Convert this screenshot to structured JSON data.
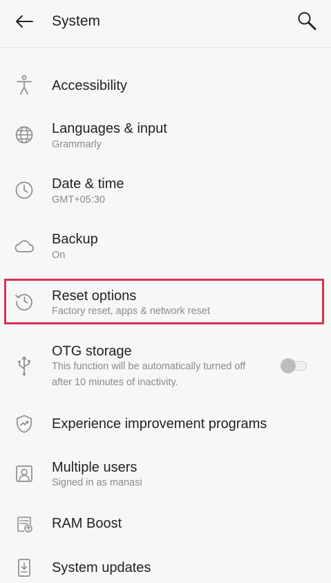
{
  "header": {
    "title": "System",
    "back_icon": "arrow-left-icon",
    "search_icon": "search-icon"
  },
  "items": [
    {
      "label": "Accessibility",
      "sub": "",
      "icon": "accessibility-icon"
    },
    {
      "label": "Languages & input",
      "sub": "Grammarly",
      "icon": "globe-icon"
    },
    {
      "label": "Date & time",
      "sub": "GMT+05:30",
      "icon": "clock-icon"
    },
    {
      "label": "Backup",
      "sub": "On",
      "icon": "cloud-icon"
    },
    {
      "label": "Reset options",
      "sub": "Factory reset, apps & network reset",
      "icon": "history-icon"
    },
    {
      "label": "OTG storage",
      "sub_line1": "This function will be automatically turned off",
      "sub_line2": "after 10 minutes of inactivity.",
      "icon": "usb-icon",
      "toggle_on": false
    },
    {
      "label": "Experience improvement programs",
      "sub": "",
      "icon": "shield-chart-icon"
    },
    {
      "label": "Multiple users",
      "sub": "Signed in as manasi",
      "icon": "user-icon"
    },
    {
      "label": "RAM Boost",
      "sub": "",
      "icon": "ram-boost-icon"
    },
    {
      "label": "System updates",
      "sub": "",
      "icon": "system-update-icon"
    }
  ],
  "colors": {
    "background": "#f7f7f7",
    "highlight_border": "#d6314f",
    "icon": "#8c8c8c",
    "subtext": "#8a8a8a"
  }
}
